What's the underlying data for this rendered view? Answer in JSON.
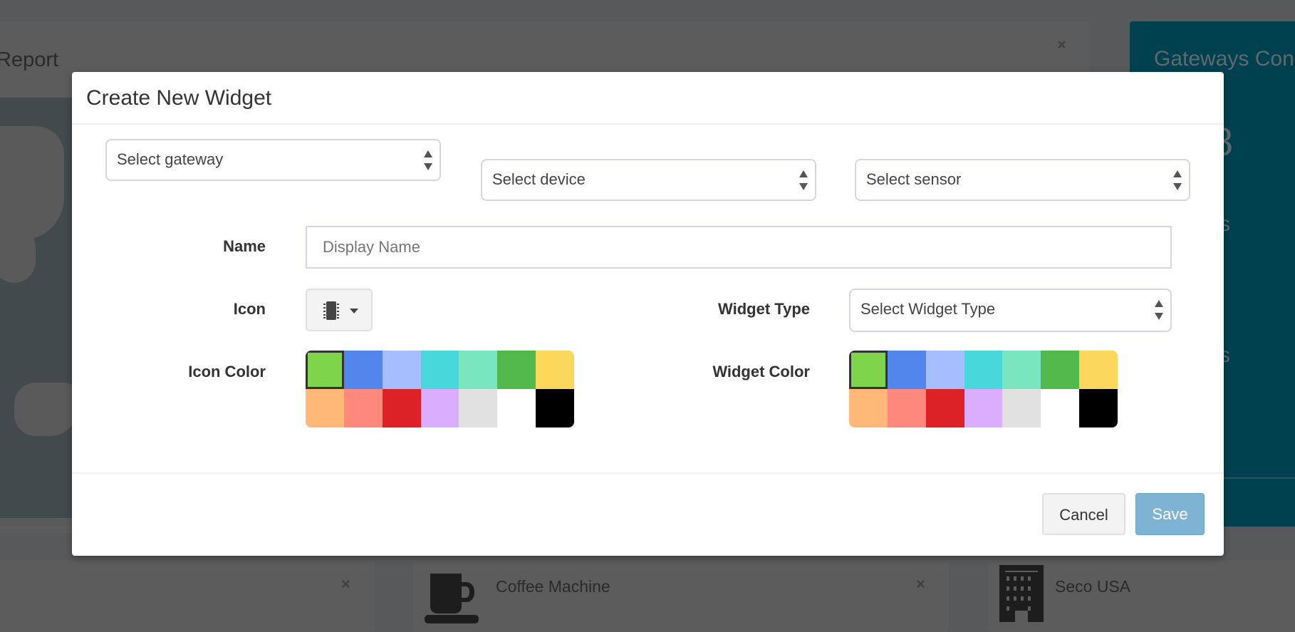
{
  "background": {
    "report_card_title": "Report",
    "gateways_card_title": "Gateways Conn",
    "gateways_count": "8",
    "gateways_line1": "s",
    "gateways_line2": "s",
    "bottom_cards": [
      {
        "label": "",
        "icon": "none"
      },
      {
        "label": "Coffee Machine",
        "icon": "coffee-cup-icon"
      },
      {
        "label": "Seco USA",
        "icon": "building-icon"
      }
    ],
    "close_glyph": "×"
  },
  "modal": {
    "title": "Create New Widget",
    "gateway_select": "Select gateway",
    "device_select": "Select device",
    "sensor_select": "Select sensor",
    "name_label": "Name",
    "name_placeholder": "Display Name",
    "name_value": "",
    "icon_label": "Icon",
    "icon_selected": "chip-icon",
    "widget_type_label": "Widget Type",
    "widget_type_select": "Select Widget Type",
    "icon_color_label": "Icon Color",
    "widget_color_label": "Widget Color",
    "colors": [
      "#7ed44a",
      "#5286ec",
      "#a5befd",
      "#48d8dc",
      "#7ae6c0",
      "#51b84b",
      "#fbd75b",
      "#ffb878",
      "#ff887c",
      "#dc2127",
      "#dbadff",
      "#e1e1e1",
      "#ffffff",
      "#000000"
    ],
    "icon_color_selected": "#7ed44a",
    "widget_color_selected": "#7ed44a",
    "cancel_label": "Cancel",
    "save_label": "Save",
    "save_color": "#7fb3d3"
  }
}
